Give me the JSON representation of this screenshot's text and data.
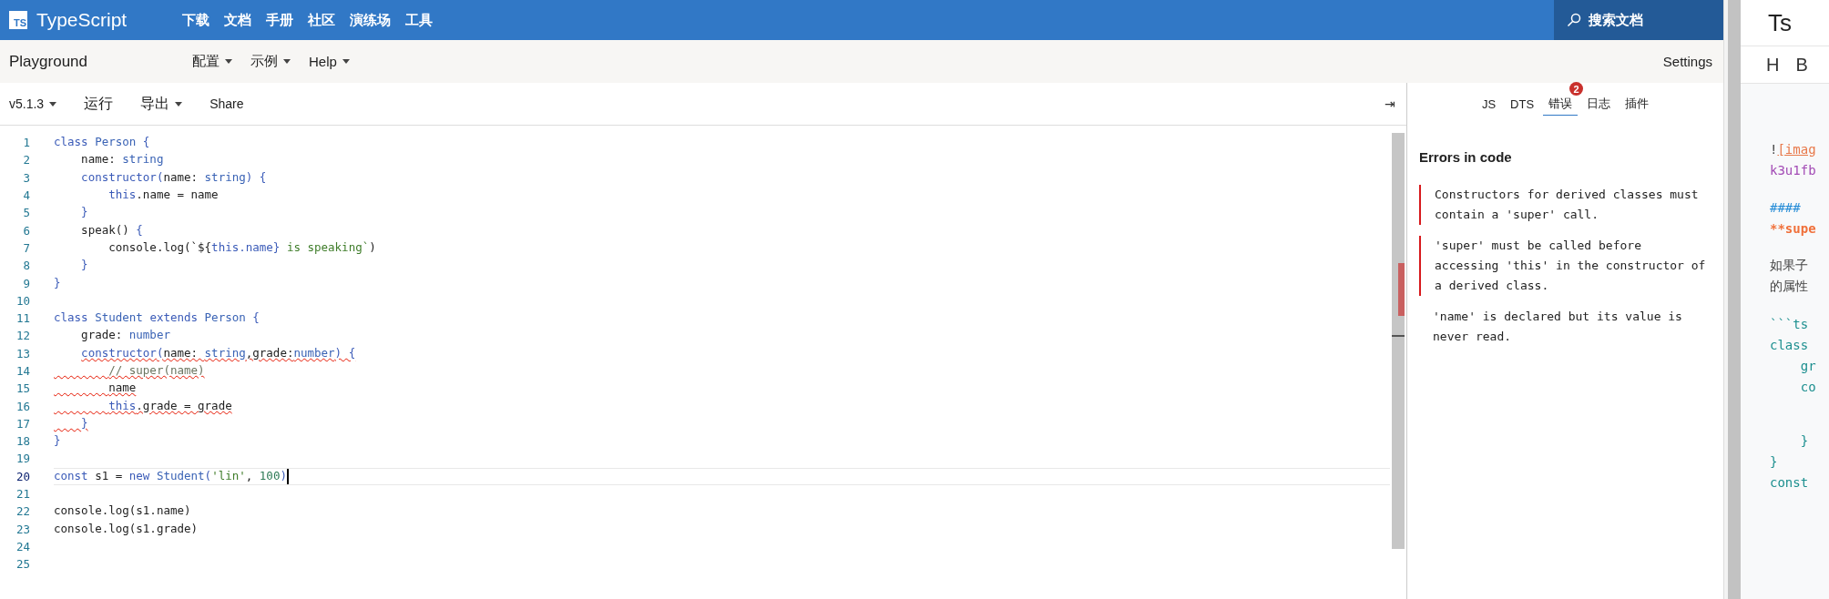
{
  "topbar": {
    "brand": "TypeScript",
    "logo": "TS",
    "nav": [
      "下载",
      "文档",
      "手册",
      "社区",
      "演练场",
      "工具"
    ],
    "search": "搜索文档"
  },
  "subbar": {
    "title": "Playground",
    "menus": [
      "配置",
      "示例",
      "Help"
    ],
    "settings": "Settings"
  },
  "toolbar": {
    "version": "v5.1.3",
    "run": "运行",
    "export": "导出",
    "share": "Share",
    "collapse": "⇥"
  },
  "editor": {
    "lines": [
      {
        "number": "1",
        "current": false,
        "tokens": [
          {
            "text": "class ",
            "kind": "kw",
            "error": false
          },
          {
            "text": "Person ",
            "kind": "type",
            "error": false
          },
          {
            "text": "{",
            "kind": "punct",
            "error": false
          }
        ]
      },
      {
        "number": "2",
        "current": false,
        "error": false,
        "tokens": [
          {
            "text": "    name: ",
            "kind": "plain",
            "error": false
          },
          {
            "text": "string",
            "kind": "type",
            "error": false
          }
        ]
      },
      {
        "number": "3",
        "current": false,
        "error": false,
        "tokens": [
          {
            "text": "    constructor",
            "kind": "kw",
            "error": false
          },
          {
            "text": "(",
            "kind": "punct",
            "error": false
          },
          {
            "text": "name: ",
            "kind": "plain",
            "error": false
          },
          {
            "text": "string",
            "kind": "type",
            "error": false
          },
          {
            "text": ") {",
            "kind": "punct",
            "error": false
          }
        ]
      },
      {
        "number": "4",
        "current": false,
        "error": false,
        "tokens": [
          {
            "text": "        this",
            "kind": "kw",
            "error": false
          },
          {
            "text": ".name = name",
            "kind": "plain",
            "error": false
          }
        ]
      },
      {
        "number": "5",
        "current": false,
        "error": false,
        "tokens": [
          {
            "text": "    }",
            "kind": "punct",
            "error": false
          }
        ]
      },
      {
        "number": "6",
        "current": false,
        "error": false,
        "tokens": [
          {
            "text": "    speak() ",
            "kind": "plain",
            "error": false
          },
          {
            "text": "{",
            "kind": "punct",
            "error": false
          }
        ]
      },
      {
        "number": "7",
        "current": false,
        "error": false,
        "tokens": [
          {
            "text": "        console.log(`${",
            "kind": "plain",
            "error": false
          },
          {
            "text": "this.name} ",
            "kind": "kw",
            "error": false
          },
          {
            "text": "is speaking`",
            "kind": "str",
            "error": false
          },
          {
            "text": ")",
            "kind": "plain",
            "error": false
          }
        ]
      },
      {
        "number": "8",
        "current": false,
        "error": false,
        "tokens": [
          {
            "text": "    }",
            "kind": "punct",
            "error": false
          }
        ]
      },
      {
        "number": "9",
        "current": false,
        "tokens": [
          {
            "text": "}",
            "kind": "punct",
            "error": false
          }
        ]
      },
      {
        "number": "10",
        "current": false
      },
      {
        "number": "11",
        "current": false,
        "tokens": [
          {
            "text": "class ",
            "kind": "kw",
            "error": false
          },
          {
            "text": "Student ",
            "kind": "type",
            "error": false
          },
          {
            "text": "extends ",
            "kind": "kw",
            "error": false
          },
          {
            "text": "Person ",
            "kind": "type",
            "error": false
          },
          {
            "text": "{",
            "kind": "punct",
            "error": false
          }
        ]
      },
      {
        "number": "12",
        "current": false,
        "error": false,
        "tokens": [
          {
            "text": "    grade: ",
            "kind": "plain",
            "error": false
          },
          {
            "text": "number",
            "kind": "type",
            "error": false
          }
        ]
      },
      {
        "number": "13",
        "current": false,
        "error": false,
        "tokens": [
          {
            "text": "    constructor",
            "kind": "kw",
            "error": true
          },
          {
            "text": "(",
            "kind": "punct",
            "error": true
          },
          {
            "text": "name: ",
            "kind": "plain",
            "error": true
          },
          {
            "text": "string",
            "kind": "type",
            "error": true
          },
          {
            "text": ",grade:",
            "kind": "plain",
            "error": true
          },
          {
            "text": "number",
            "kind": "type",
            "error": true
          },
          {
            "text": ") {",
            "kind": "punct",
            "error": true
          }
        ]
      },
      {
        "number": "14",
        "current": false,
        "error": true,
        "tokens": [
          {
            "text": "        // super(name)",
            "kind": "cmt",
            "error": true
          }
        ]
      },
      {
        "number": "15",
        "current": false,
        "error": true,
        "tokens": [
          {
            "text": "        name",
            "kind": "plain",
            "error": true
          }
        ]
      },
      {
        "number": "16",
        "current": false,
        "error": true,
        "tokens": [
          {
            "text": "        this",
            "kind": "kw",
            "error": true
          },
          {
            "text": ".grade = grade",
            "kind": "plain",
            "error": true
          }
        ]
      },
      {
        "number": "17",
        "current": false,
        "error": true,
        "tokens": [
          {
            "text": "    }",
            "kind": "punct",
            "error": true
          }
        ]
      },
      {
        "number": "18",
        "current": false,
        "tokens": [
          {
            "text": "}",
            "kind": "punct",
            "error": false
          }
        ]
      },
      {
        "number": "19",
        "current": false
      },
      {
        "number": "20",
        "current": true,
        "tokens": [
          {
            "text": "const ",
            "kind": "kw",
            "error": false
          },
          {
            "text": "s1 = ",
            "kind": "plain",
            "error": false
          },
          {
            "text": "new ",
            "kind": "kw",
            "error": false
          },
          {
            "text": "Student",
            "kind": "type",
            "error": false
          },
          {
            "text": "(",
            "kind": "punct",
            "error": false
          },
          {
            "text": "'lin'",
            "kind": "str",
            "error": false
          },
          {
            "text": ", ",
            "kind": "plain",
            "error": false
          },
          {
            "text": "100",
            "kind": "num",
            "error": false
          },
          {
            "text": ")",
            "kind": "punct",
            "error": false
          }
        ]
      },
      {
        "number": "21",
        "current": false
      },
      {
        "number": "22",
        "current": false,
        "tokens": [
          {
            "text": "console.log(s1.name)",
            "kind": "plain",
            "error": false
          }
        ]
      },
      {
        "number": "23",
        "current": false,
        "tokens": [
          {
            "text": "console.log(s1.grade)",
            "kind": "plain",
            "error": false
          }
        ]
      },
      {
        "number": "24",
        "current": false
      },
      {
        "number": "25",
        "current": false
      }
    ]
  },
  "output": {
    "tabs": [
      {
        "label": "JS",
        "selected": false
      },
      {
        "label": "DTS",
        "selected": false
      },
      {
        "label": "错误",
        "selected": true,
        "badge": "2"
      },
      {
        "label": "日志",
        "selected": false
      },
      {
        "label": "插件",
        "selected": false
      }
    ],
    "heading": "Errors in code",
    "errors": [
      {
        "kind": "error",
        "text": "Constructors for derived classes must contain a 'super' call."
      },
      {
        "kind": "error",
        "text": "'super' must be called before accessing 'this' in the constructor of a derived class."
      },
      {
        "kind": "unused",
        "text": "'name' is declared but its value is never read."
      }
    ]
  },
  "markdown": {
    "title": "Ts",
    "tools": [
      "H",
      "B"
    ],
    "lines": [
      {
        "kind": "text",
        "tokens": [
          {
            "text": "!",
            "kind": "plain"
          },
          {
            "text": "[imag",
            "kind": "link"
          }
        ]
      },
      {
        "kind": "text",
        "tokens": [
          {
            "text": "k3u1fb",
            "kind": "url"
          }
        ]
      },
      {
        "kind": "blank"
      },
      {
        "kind": "text",
        "tokens": [
          {
            "text": "####",
            "kind": "heading"
          }
        ]
      },
      {
        "kind": "text",
        "tokens": [
          {
            "text": "**supe",
            "kind": "bold"
          }
        ]
      },
      {
        "kind": "blank"
      },
      {
        "kind": "text",
        "tokens": [
          {
            "text": "如果子",
            "kind": "plain"
          }
        ]
      },
      {
        "kind": "text",
        "tokens": [
          {
            "text": "的属性",
            "kind": "plain"
          }
        ]
      },
      {
        "kind": "blank"
      },
      {
        "kind": "text",
        "tokens": [
          {
            "text": "```ts",
            "kind": "code"
          }
        ]
      },
      {
        "kind": "text",
        "tokens": [
          {
            "text": "class",
            "kind": "code"
          }
        ]
      },
      {
        "kind": "text",
        "tokens": [
          {
            "text": "    gr",
            "kind": "code"
          }
        ]
      },
      {
        "kind": "text",
        "tokens": [
          {
            "text": "    co",
            "kind": "code"
          }
        ]
      },
      {
        "kind": "blank"
      },
      {
        "kind": "blank"
      },
      {
        "kind": "text",
        "tokens": [
          {
            "text": "    }",
            "kind": "code"
          }
        ]
      },
      {
        "kind": "text",
        "tokens": [
          {
            "text": "}",
            "kind": "code"
          }
        ]
      },
      {
        "kind": "text",
        "tokens": [
          {
            "text": "const",
            "kind": "code"
          }
        ]
      }
    ]
  }
}
